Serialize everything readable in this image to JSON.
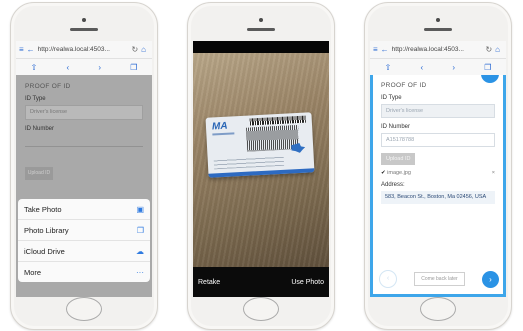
{
  "browser": {
    "url": "http://realwa.local:4503...",
    "url_short": "http://realwa.local:4503...",
    "icons": [
      "menu-icon",
      "back-arrow-icon",
      "reload-icon",
      "home-icon",
      "share-icon",
      "prev-icon",
      "next-icon",
      "tabs-icon"
    ]
  },
  "screen1": {
    "section_title": "PROOF OF ID",
    "id_type_label": "ID Type",
    "id_type_value": "Driver's license",
    "id_number_label": "ID Number",
    "upload_label": "Upload ID",
    "sheet": [
      {
        "label": "Take Photo",
        "icon": "camera-icon"
      },
      {
        "label": "Photo Library",
        "icon": "photo-library-icon"
      },
      {
        "label": "iCloud Drive",
        "icon": "cloud-icon"
      },
      {
        "label": "More",
        "icon": "more-icon"
      }
    ]
  },
  "screen2": {
    "retake_label": "Retake",
    "use_label": "Use Photo",
    "license_state": "MA"
  },
  "screen3": {
    "section_title": "PROOF OF ID",
    "id_type_label": "ID Type",
    "id_type_value": "Driver's license",
    "id_number_label": "ID Number",
    "id_number_value": "A15178788",
    "upload_label": "Upload ID",
    "file_name": "image.jpg",
    "address_label": "Address:",
    "address_value": "583, Beacon St., Boston, Ma 02456, USA",
    "come_back_label": "Come back later"
  },
  "colors": {
    "accent": "#2b93e5",
    "page_blue": "#3ea6ea",
    "overlay_gray": "#a9a9a9"
  }
}
